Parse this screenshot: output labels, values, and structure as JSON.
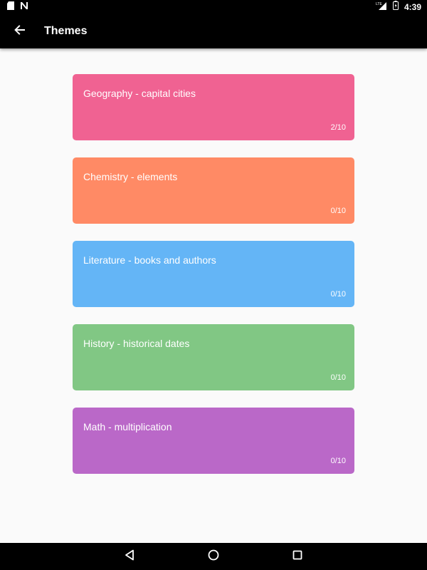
{
  "status_bar": {
    "time": "4:39",
    "network_label": "LTE",
    "icons": [
      "sd-card-icon",
      "n-app-icon",
      "signal-icon",
      "battery-icon"
    ]
  },
  "app_bar": {
    "title": "Themes",
    "back_icon": "arrow-left-icon"
  },
  "themes": [
    {
      "title": "Geography - capital cities",
      "progress": "2/10",
      "color": "#f06292"
    },
    {
      "title": "Chemistry - elements",
      "progress": "0/10",
      "color": "#ff8a65"
    },
    {
      "title": "Literature - books and authors",
      "progress": "0/10",
      "color": "#64b5f6"
    },
    {
      "title": "History - historical dates",
      "progress": "0/10",
      "color": "#81c784"
    },
    {
      "title": "Math - multiplication",
      "progress": "0/10",
      "color": "#ba68c8"
    }
  ],
  "nav_bar": {
    "icons": [
      "back-triangle-icon",
      "home-circle-icon",
      "recents-square-icon"
    ]
  }
}
